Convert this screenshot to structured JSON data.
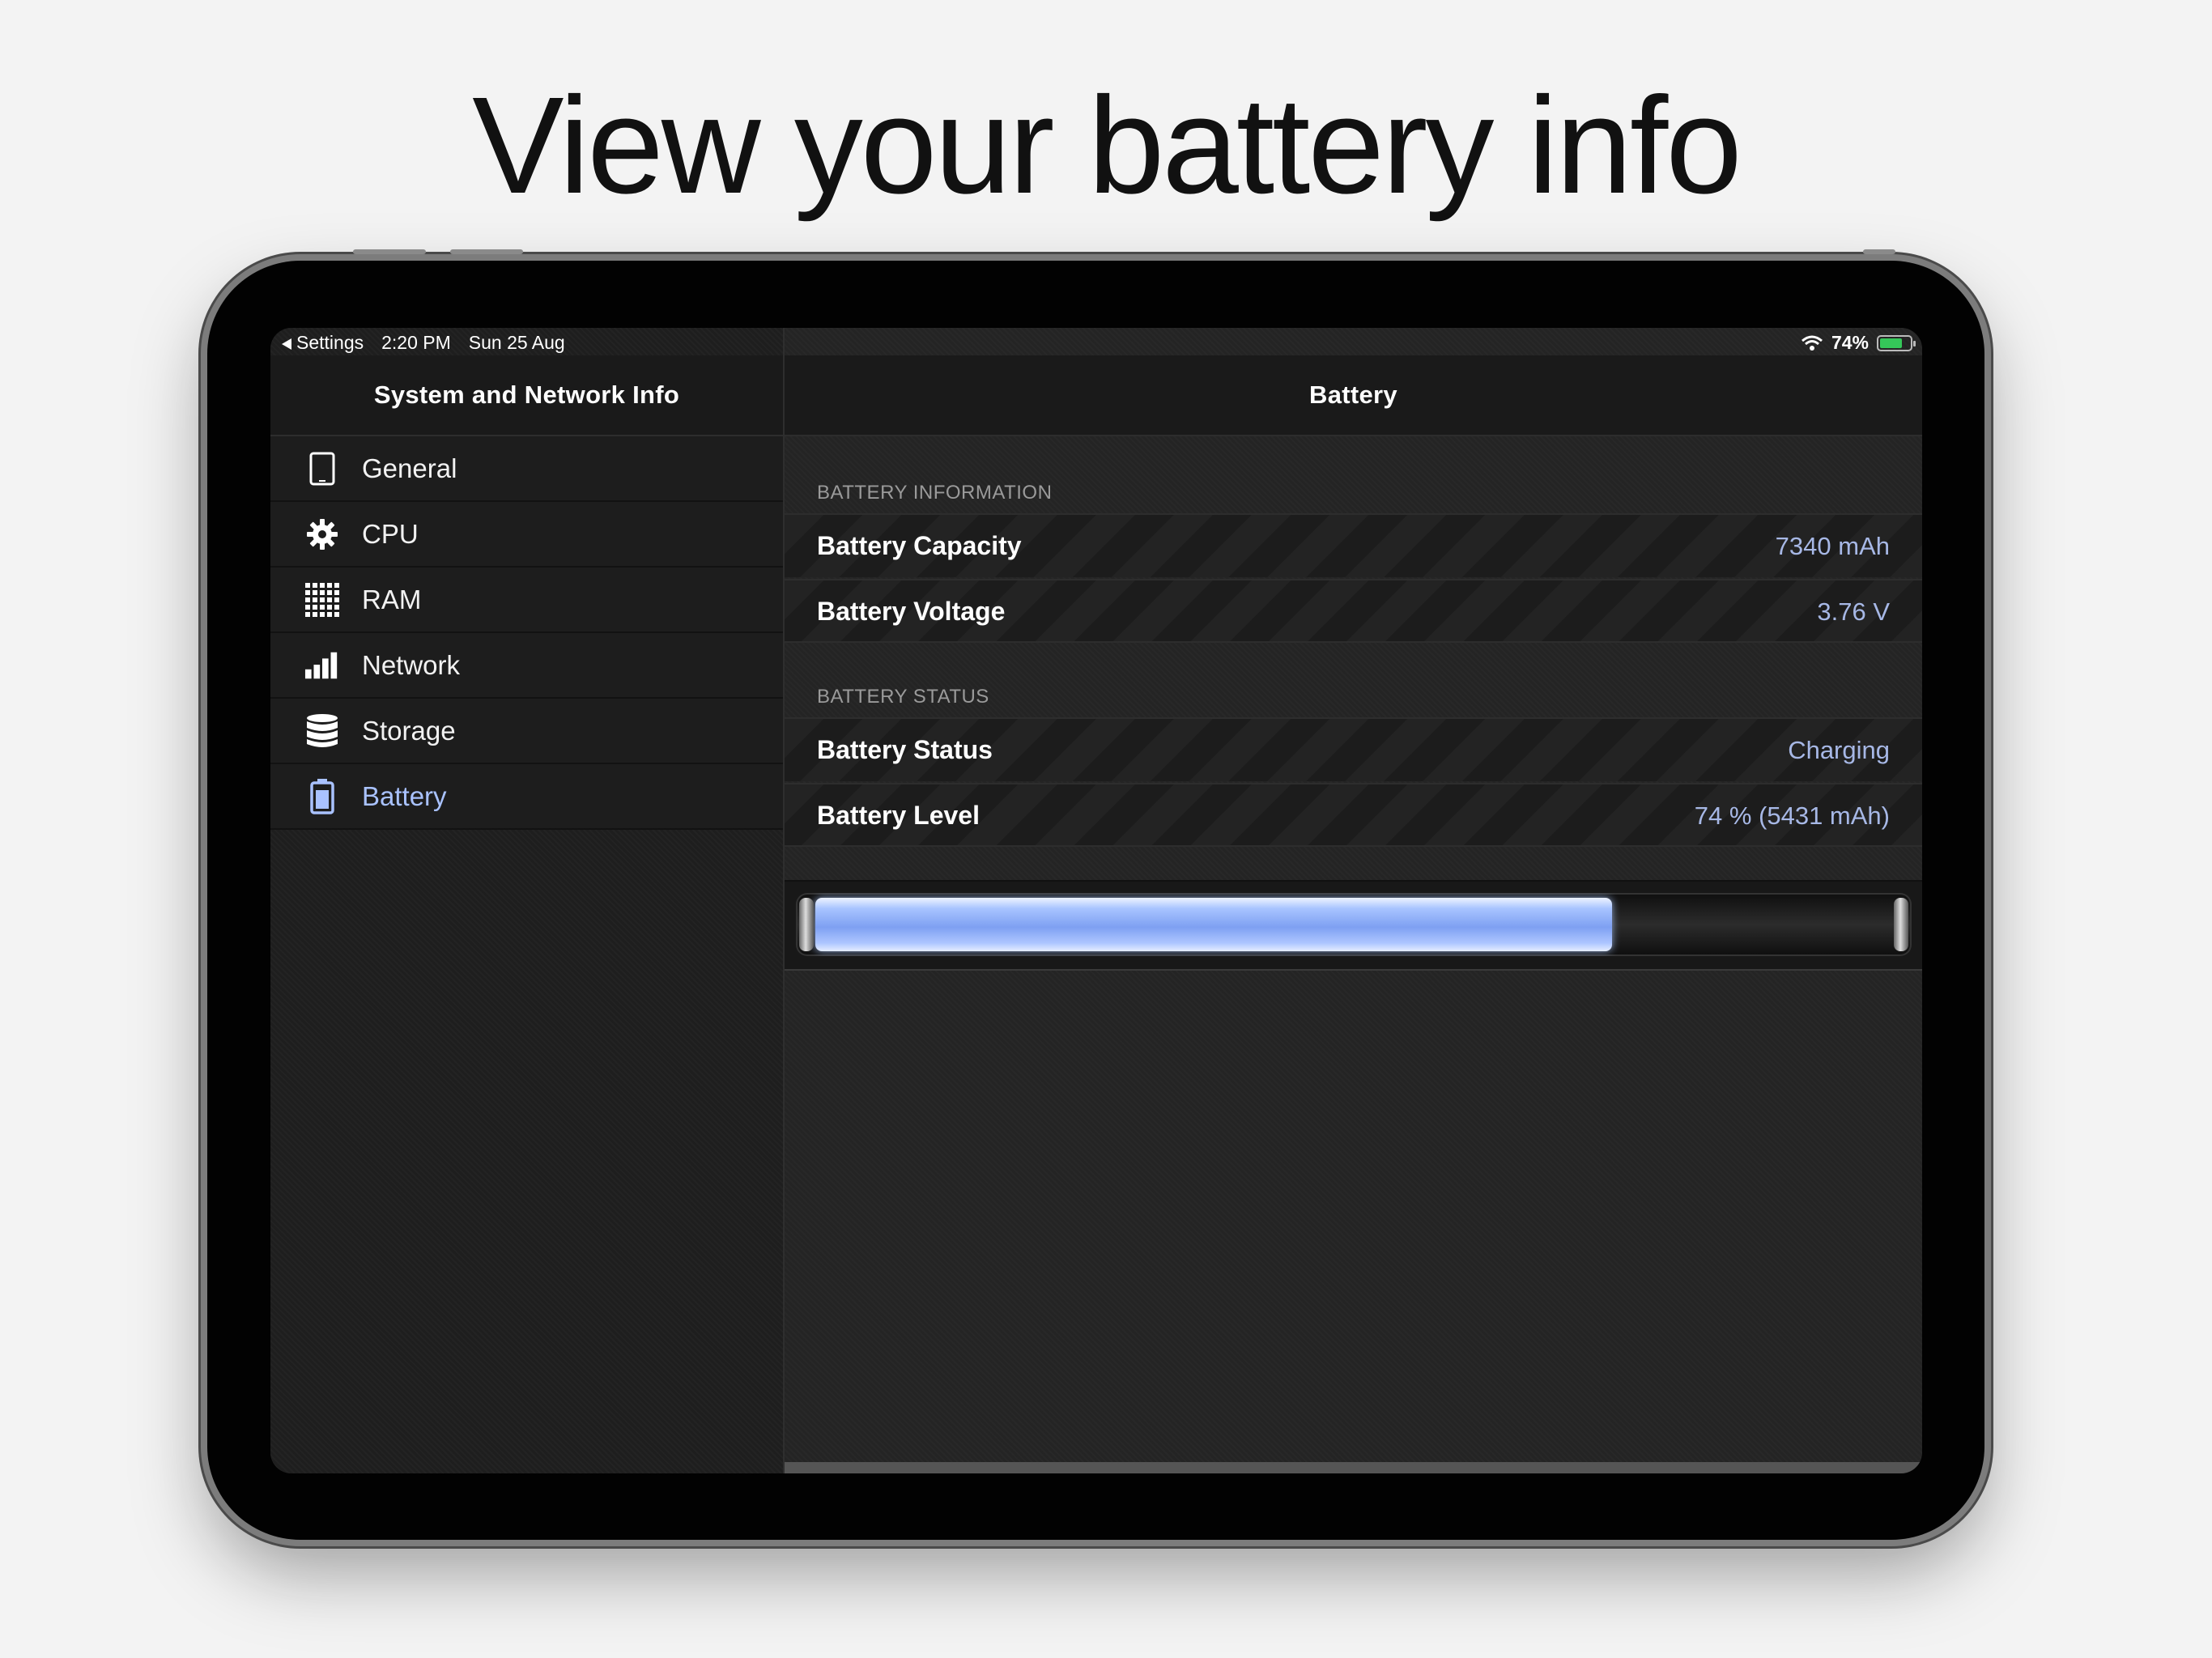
{
  "headline": "View your battery info",
  "status_bar": {
    "back_label": "Settings",
    "time": "2:20 PM",
    "date": "Sun 25 Aug",
    "battery_percent": "74%",
    "battery_level": 0.74
  },
  "sidebar": {
    "title": "System and Network Info",
    "items": [
      {
        "label": "General",
        "icon": "tablet-icon"
      },
      {
        "label": "CPU",
        "icon": "gear-icon"
      },
      {
        "label": "RAM",
        "icon": "grid-icon"
      },
      {
        "label": "Network",
        "icon": "signal-bars-icon"
      },
      {
        "label": "Storage",
        "icon": "database-icon"
      },
      {
        "label": "Battery",
        "icon": "battery-icon",
        "active": true
      }
    ]
  },
  "main": {
    "title": "Battery",
    "sections": [
      {
        "header": "BATTERY INFORMATION",
        "rows": [
          {
            "label": "Battery Capacity",
            "value": "7340 mAh"
          },
          {
            "label": "Battery Voltage",
            "value": "3.76 V"
          }
        ]
      },
      {
        "header": "BATTERY STATUS",
        "rows": [
          {
            "label": "Battery Status",
            "value": "Charging"
          },
          {
            "label": "Battery Level",
            "value": "74 % (5431 mAh)"
          }
        ]
      }
    ],
    "level_fraction": 0.74
  },
  "colors": {
    "accent": "#a9c2ff",
    "value_text": "#a7b8e6",
    "charging_green": "#35c759"
  }
}
